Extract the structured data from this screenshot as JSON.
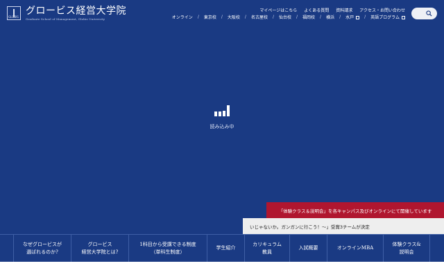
{
  "header": {
    "logo_mark_text": "GLOBIS",
    "logo_title": "グロービス経営大学院",
    "logo_subtitle": "Graduate School of Management, Globis University",
    "utility_links": [
      "マイページはこちら",
      "よくある質問",
      "資料請求",
      "アクセス・お問い合わせ"
    ],
    "main_nav": [
      "オンライン",
      "東京校",
      "大阪校",
      "名古屋校",
      "仙台校",
      "福岡校",
      "横浜",
      "水戸",
      "英語プログラム"
    ],
    "search_icon": "search-icon"
  },
  "loader": {
    "text": "読み込み中"
  },
  "banners": {
    "red": "「体験クラス＆説明会」を各キャンパス及びオンラインにて開催しています",
    "gray": "いじゃないか。ガンガンに行こう！〜」受賞3チームが決定"
  },
  "bottom_nav": [
    "なぜグロービスが\n選ばれるのか?",
    "グロービス\n経営大学院とは?",
    "1科目から受講できる制度\n（単科生制度）",
    "学生紹介",
    "カリキュラム\n教員",
    "入試概要",
    "オンラインMBA",
    "体験クラス&\n説明会"
  ],
  "colors": {
    "navy": "#1a3a83",
    "accent_red": "#b0162f"
  }
}
